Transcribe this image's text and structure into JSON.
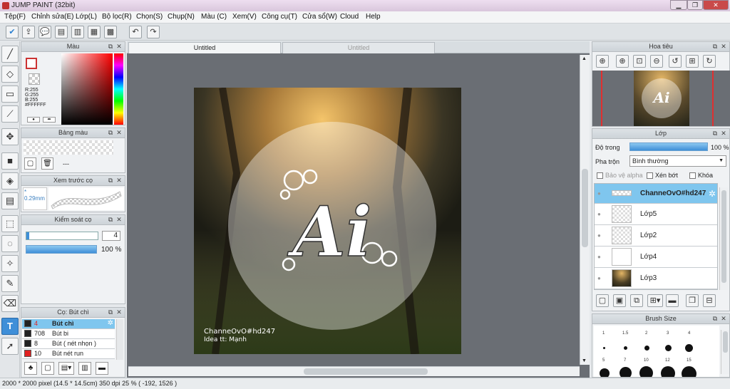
{
  "window": {
    "title": "JUMP PAINT (32bit)",
    "min": "▁",
    "restore": "❐",
    "close": "✕"
  },
  "menu": [
    "Tệp(F)",
    "Chỉnh sửa(E)",
    "Lớp(L)",
    "Bộ lọc(R)",
    "Chọn(S)",
    "Chụp(N)",
    "Màu (C)",
    "Xem(V)",
    "Công cụ(T)",
    "Cửa sổ(W)",
    "Cloud",
    "Help"
  ],
  "tabs": {
    "active": "Untitled",
    "inactive": "Untitled"
  },
  "color_panel": {
    "title": "Màu",
    "r": "R:255",
    "g": "G:255",
    "b": "B:255",
    "hex": "#FFFFFF"
  },
  "palette_panel": {
    "title": "Bảng màu",
    "dash": "---"
  },
  "brush_preview": {
    "title": "Xem trước cọ",
    "size": "0.29mm"
  },
  "brush_control": {
    "title": "Kiểm soát cọ",
    "size": "4",
    "opacity": "100 %",
    "opacity_value": 100
  },
  "brush_list": {
    "title": "Cọ: Bút chì",
    "items": [
      {
        "size": "4",
        "name": "Bút chì",
        "color": "#222222",
        "selected": true
      },
      {
        "size": "708",
        "name": "Bút bi",
        "color": "#222222",
        "selected": false
      },
      {
        "size": "8",
        "name": "Bút ( nét nhọn )",
        "color": "#222222",
        "selected": false
      },
      {
        "size": "10",
        "name": "Bút nét run",
        "color": "#e02020",
        "selected": false
      }
    ]
  },
  "canvas": {
    "watermark_line1": "ChanneOvO#hd247",
    "watermark_line2": "Idea tt: Mạnh",
    "logo_text": "Ai"
  },
  "navigator": {
    "title": "Hoa tiêu"
  },
  "layers_panel": {
    "title": "Lớp",
    "opacity_label": "Độ trong",
    "opacity_value": "100 %",
    "opacity_fraction": 1.0,
    "blend_label": "Pha trộn",
    "blend_value": "Bình thường",
    "protect_alpha": "Bảo vệ alpha",
    "clipping": "Xén bớt",
    "lock": "Khóa",
    "layers": [
      {
        "name": "ChanneOvO#hd247",
        "selected": true
      },
      {
        "name": "Lớp5",
        "selected": false
      },
      {
        "name": "Lớp2",
        "selected": false
      },
      {
        "name": "Lớp4",
        "selected": false
      },
      {
        "name": "Lớp3",
        "selected": false
      }
    ]
  },
  "brush_size_panel": {
    "title": "Brush Size",
    "labels": [
      "1",
      "1.5",
      "2",
      "3",
      "4",
      "5",
      "7",
      "10",
      "12",
      "15"
    ]
  },
  "status": {
    "text": "2000 * 2000 pixel  (14.5 * 14.5cm)  350 dpi  25 %  ( -192, 1526 )"
  },
  "colors": {
    "accent": "#3f8fd8",
    "selected_row": "#7fc6ee",
    "canvas_bg": "#6a6e74"
  }
}
